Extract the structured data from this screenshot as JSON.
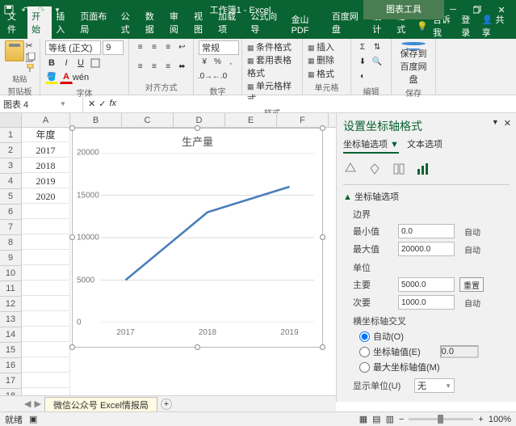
{
  "titlebar": {
    "app_title": "工作簿1 - Excel",
    "tool_tab": "图表工具"
  },
  "tabs": {
    "file": "文件",
    "home": "开始",
    "insert": "插入",
    "layout": "页面布局",
    "formula": "公式",
    "data": "数据",
    "review": "审阅",
    "view": "视图",
    "addin": "加载项",
    "fg": "公式向导",
    "wps": "金山PDF",
    "baidu": "百度网盘",
    "design": "设计",
    "format": "格式",
    "tell": "告诉我",
    "login": "登录",
    "share": "共享"
  },
  "ribbon": {
    "clipboard": {
      "paste": "粘贴",
      "label": "剪贴板"
    },
    "font": {
      "name": "等线 (正文)",
      "size": "9",
      "label": "字体"
    },
    "align": {
      "label": "对齐方式"
    },
    "number": {
      "combo": "常规",
      "label": "数字"
    },
    "styles": {
      "cond": "条件格式",
      "table": "套用表格格式",
      "cell": "单元格样式",
      "label": "样式"
    },
    "cells": {
      "insert": "插入",
      "delete": "删除",
      "format": "格式",
      "label": "单元格"
    },
    "editing": {
      "label": "编辑"
    },
    "baidu": {
      "save": "保存到",
      "target": "百度网盘",
      "label": "保存"
    }
  },
  "namebox": {
    "value": "图表 4",
    "fx": "fx"
  },
  "cells": {
    "a1": "年度",
    "a2": "2017",
    "a3": "2018",
    "a4": "2019",
    "a5": "2020"
  },
  "chart": {
    "title": "生产量"
  },
  "chart_data": {
    "type": "line",
    "title": "生产量",
    "categories": [
      "2017",
      "2018",
      "2019"
    ],
    "values": [
      5000,
      13000,
      16000
    ],
    "ylim": [
      0,
      20000
    ],
    "ytick_step": 5000,
    "xlabel": "",
    "ylabel": ""
  },
  "pane": {
    "title": "设置坐标轴格式",
    "tab_axis": "坐标轴选项",
    "tab_text": "文本选项",
    "section_axis": "坐标轴选项",
    "bounds": "边界",
    "min": "最小值",
    "min_v": "0.0",
    "max": "最大值",
    "max_v": "20000.0",
    "auto": "自动",
    "units": "单位",
    "major": "主要",
    "major_v": "5000.0",
    "reset": "重置",
    "minor": "次要",
    "minor_v": "1000.0",
    "cross": "横坐标轴交叉",
    "r_auto": "自动(O)",
    "r_val": "坐标轴值(E)",
    "r_val_v": "0.0",
    "r_max": "最大坐标轴值(M)",
    "disp_unit": "显示单位(U)",
    "disp_unit_v": "无"
  },
  "sheet": {
    "tab": "微信公众号 Excel情报局"
  },
  "status": {
    "ready": "就绪",
    "zoom": "100%"
  }
}
